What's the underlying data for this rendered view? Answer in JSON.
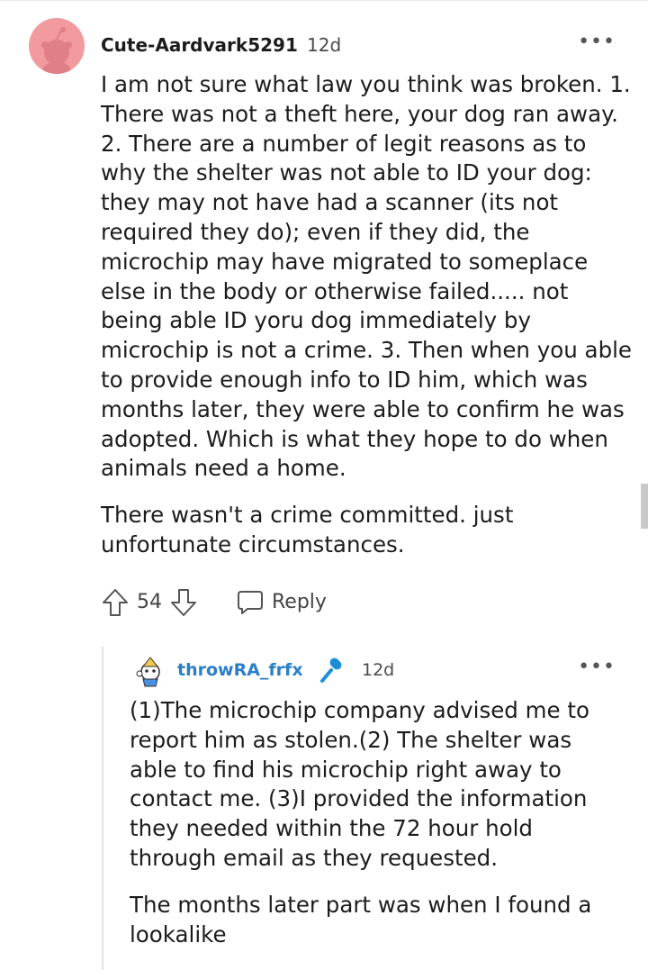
{
  "comment1": {
    "author": "Cute-Aardvark5291",
    "time": "12d",
    "more": "•••",
    "avatar_icon": "snoo-avatar-icon",
    "paragraphs": [
      "I am not sure what law you think was broken. 1. There was not a theft here, your dog ran away. 2. There are a number of legit reasons as to why the shelter was not able to ID your dog: they may not have had a scanner (its not required they do); even if they did, the microchip may have migrated to someplace else in the body or otherwise failed..... not being able ID yoru dog immediately by microchip is not a crime. 3. Then when you able to provide enough info to ID him, which was months later, they were able to confirm he was adopted. Which is what they hope to do when animals need a home.",
      "There wasn't a crime committed. just unfortunate circumstances."
    ],
    "score": "54",
    "reply_label": "Reply"
  },
  "comment2": {
    "author": "throwRA_frfx",
    "time": "12d",
    "more": "•••",
    "badge_icon": "microphone-icon",
    "paragraphs": [
      "(1)The microchip company advised me to report him as stolen.(2) The shelter was able to find his microchip right away to contact me. (3)I provided the information they needed within the 72 hour hold through email as they requested.",
      "The months later part was when I found a lookalike"
    ]
  },
  "colors": {
    "avatar_bg": "#f39a9f",
    "author2": "#2a7fc9",
    "mic_badge": "#1a8fd8"
  }
}
